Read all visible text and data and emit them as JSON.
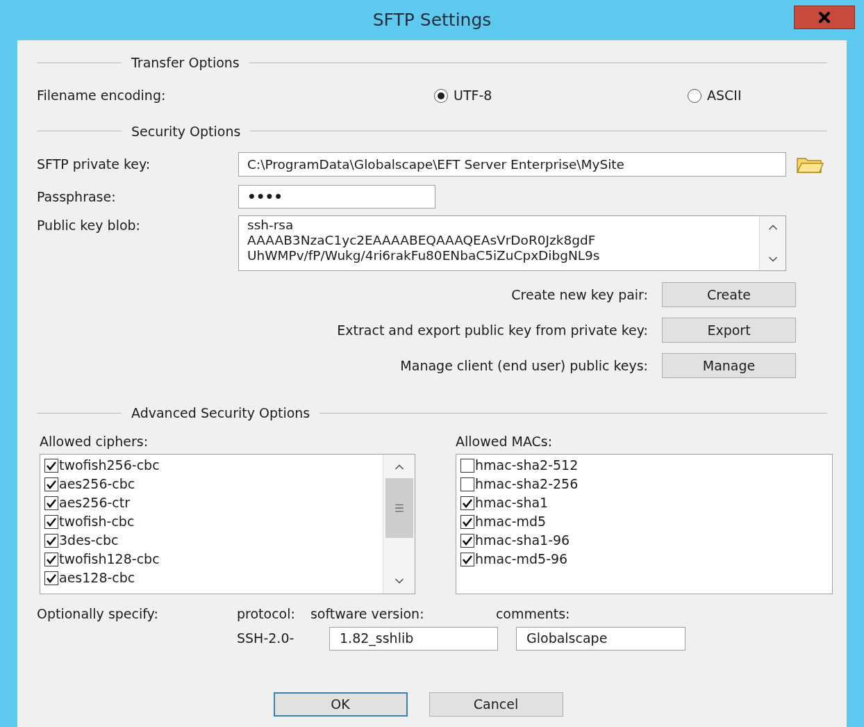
{
  "window": {
    "title": "SFTP Settings"
  },
  "transfer_options": {
    "heading": "Transfer Options",
    "encoding_label": "Filename encoding:",
    "encodings": [
      {
        "label": "UTF-8",
        "selected": true
      },
      {
        "label": "ASCII",
        "selected": false
      }
    ]
  },
  "security_options": {
    "heading": "Security Options",
    "private_key": {
      "label": "SFTP private key:",
      "value": "C:\\ProgramData\\Globalscape\\EFT Server Enterprise\\MySite"
    },
    "passphrase": {
      "label": "Passphrase:",
      "value": "••••"
    },
    "public_key_blob": {
      "label": "Public key blob:",
      "lines": [
        "ssh-rsa",
        "AAAAB3NzaC1yc2EAAAABEQAAAQEAsVrDoR0Jzk8gdF",
        "UhWMPv/fP/Wukg/4ri6rakFu80ENbaC5iZuCpxDibgNL9s"
      ]
    },
    "actions": [
      {
        "label": "Create new key pair:",
        "button": "Create"
      },
      {
        "label": "Extract and export public key from private key:",
        "button": "Export"
      },
      {
        "label": "Manage client (end user) public keys:",
        "button": "Manage"
      }
    ]
  },
  "advanced_security_options": {
    "heading": "Advanced Security Options",
    "ciphers": {
      "label": "Allowed ciphers:",
      "items": [
        {
          "name": "twofish256-cbc",
          "checked": true
        },
        {
          "name": "aes256-cbc",
          "checked": true
        },
        {
          "name": "aes256-ctr",
          "checked": true
        },
        {
          "name": "twofish-cbc",
          "checked": true
        },
        {
          "name": "3des-cbc",
          "checked": true
        },
        {
          "name": "twofish128-cbc",
          "checked": true
        },
        {
          "name": "aes128-cbc",
          "checked": true
        }
      ]
    },
    "macs": {
      "label": "Allowed MACs:",
      "items": [
        {
          "name": "hmac-sha2-512",
          "checked": false
        },
        {
          "name": "hmac-sha2-256",
          "checked": false
        },
        {
          "name": "hmac-sha1",
          "checked": true
        },
        {
          "name": "hmac-md5",
          "checked": true
        },
        {
          "name": "hmac-sha1-96",
          "checked": true
        },
        {
          "name": "hmac-md5-96",
          "checked": true
        }
      ]
    },
    "optional": {
      "label": "Optionally specify:",
      "protocol_label": "protocol:",
      "protocol_value": "SSH-2.0-",
      "software_label": "software version:",
      "software_value": "1.82_sshlib",
      "comments_label": "comments:",
      "comments_value": "Globalscape"
    }
  },
  "buttons": [
    "OK",
    "Cancel"
  ]
}
